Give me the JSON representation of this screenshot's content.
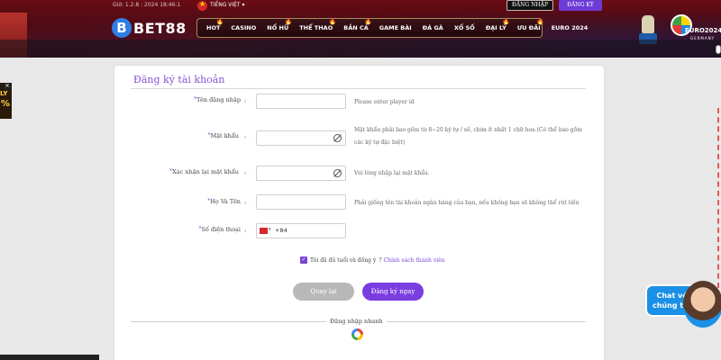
{
  "header": {
    "date": "Giờ: 1.2.8 : 2024 18:46:1",
    "language": "TIẾNG VIỆT ▾",
    "login_label": "ĐĂNG NHẬP",
    "register_label": "ĐĂNG KÝ",
    "logo_badge": "B",
    "logo_text": "BET88",
    "nav": [
      "HOT",
      "CASINO",
      "NỔ HŨ",
      "THỂ THAO",
      "BẮN CÁ",
      "GAME BÀI",
      "ĐÁ GÀ",
      "XỔ SỐ",
      "ĐẠI LÝ",
      "ƯU ĐÃI",
      "EURO 2024"
    ],
    "euro_text": "EURO2024",
    "euro_sub": "GERMANY"
  },
  "form": {
    "title": "Đăng ký tài khoản",
    "fields": [
      {
        "label": "Tên đăng nhập",
        "value": "",
        "hint": "Please enter player id"
      },
      {
        "label": "Mật khẩu",
        "value": "",
        "hint": "Mật khẩu phải bao gồm từ 8~20 ký tự / số, chứa ít nhất 1 chữ hoa.(Có thể bao gồm các ký tự đặc biệt)"
      },
      {
        "label": "Xác nhận lại mật khẩu",
        "value": "",
        "hint": "Vui lòng nhập lại mật khẩu."
      },
      {
        "label": "Họ Và Tên",
        "value": "",
        "hint": "Phải giống tên tài khoản ngân hàng của bạn, nếu không bạn sẽ không thể rút tiền"
      },
      {
        "label": "Số điện thoại",
        "value": "+84",
        "hint": ""
      }
    ],
    "required_mark": "*",
    "colon": ":",
    "agree_text": "Tôi đã đủ tuổi và đồng ý",
    "agree_link": "Chính sách thành viên",
    "back_button": "Quay lại",
    "submit_button": "Đăng ký ngay",
    "quick_login": "Đăng nhập nhanh"
  },
  "chat": {
    "line1": "Chat với",
    "line2": "chúng tôi!"
  },
  "left_banner": {
    "ly": "LY",
    "pct": "%",
    "close": "✕"
  }
}
